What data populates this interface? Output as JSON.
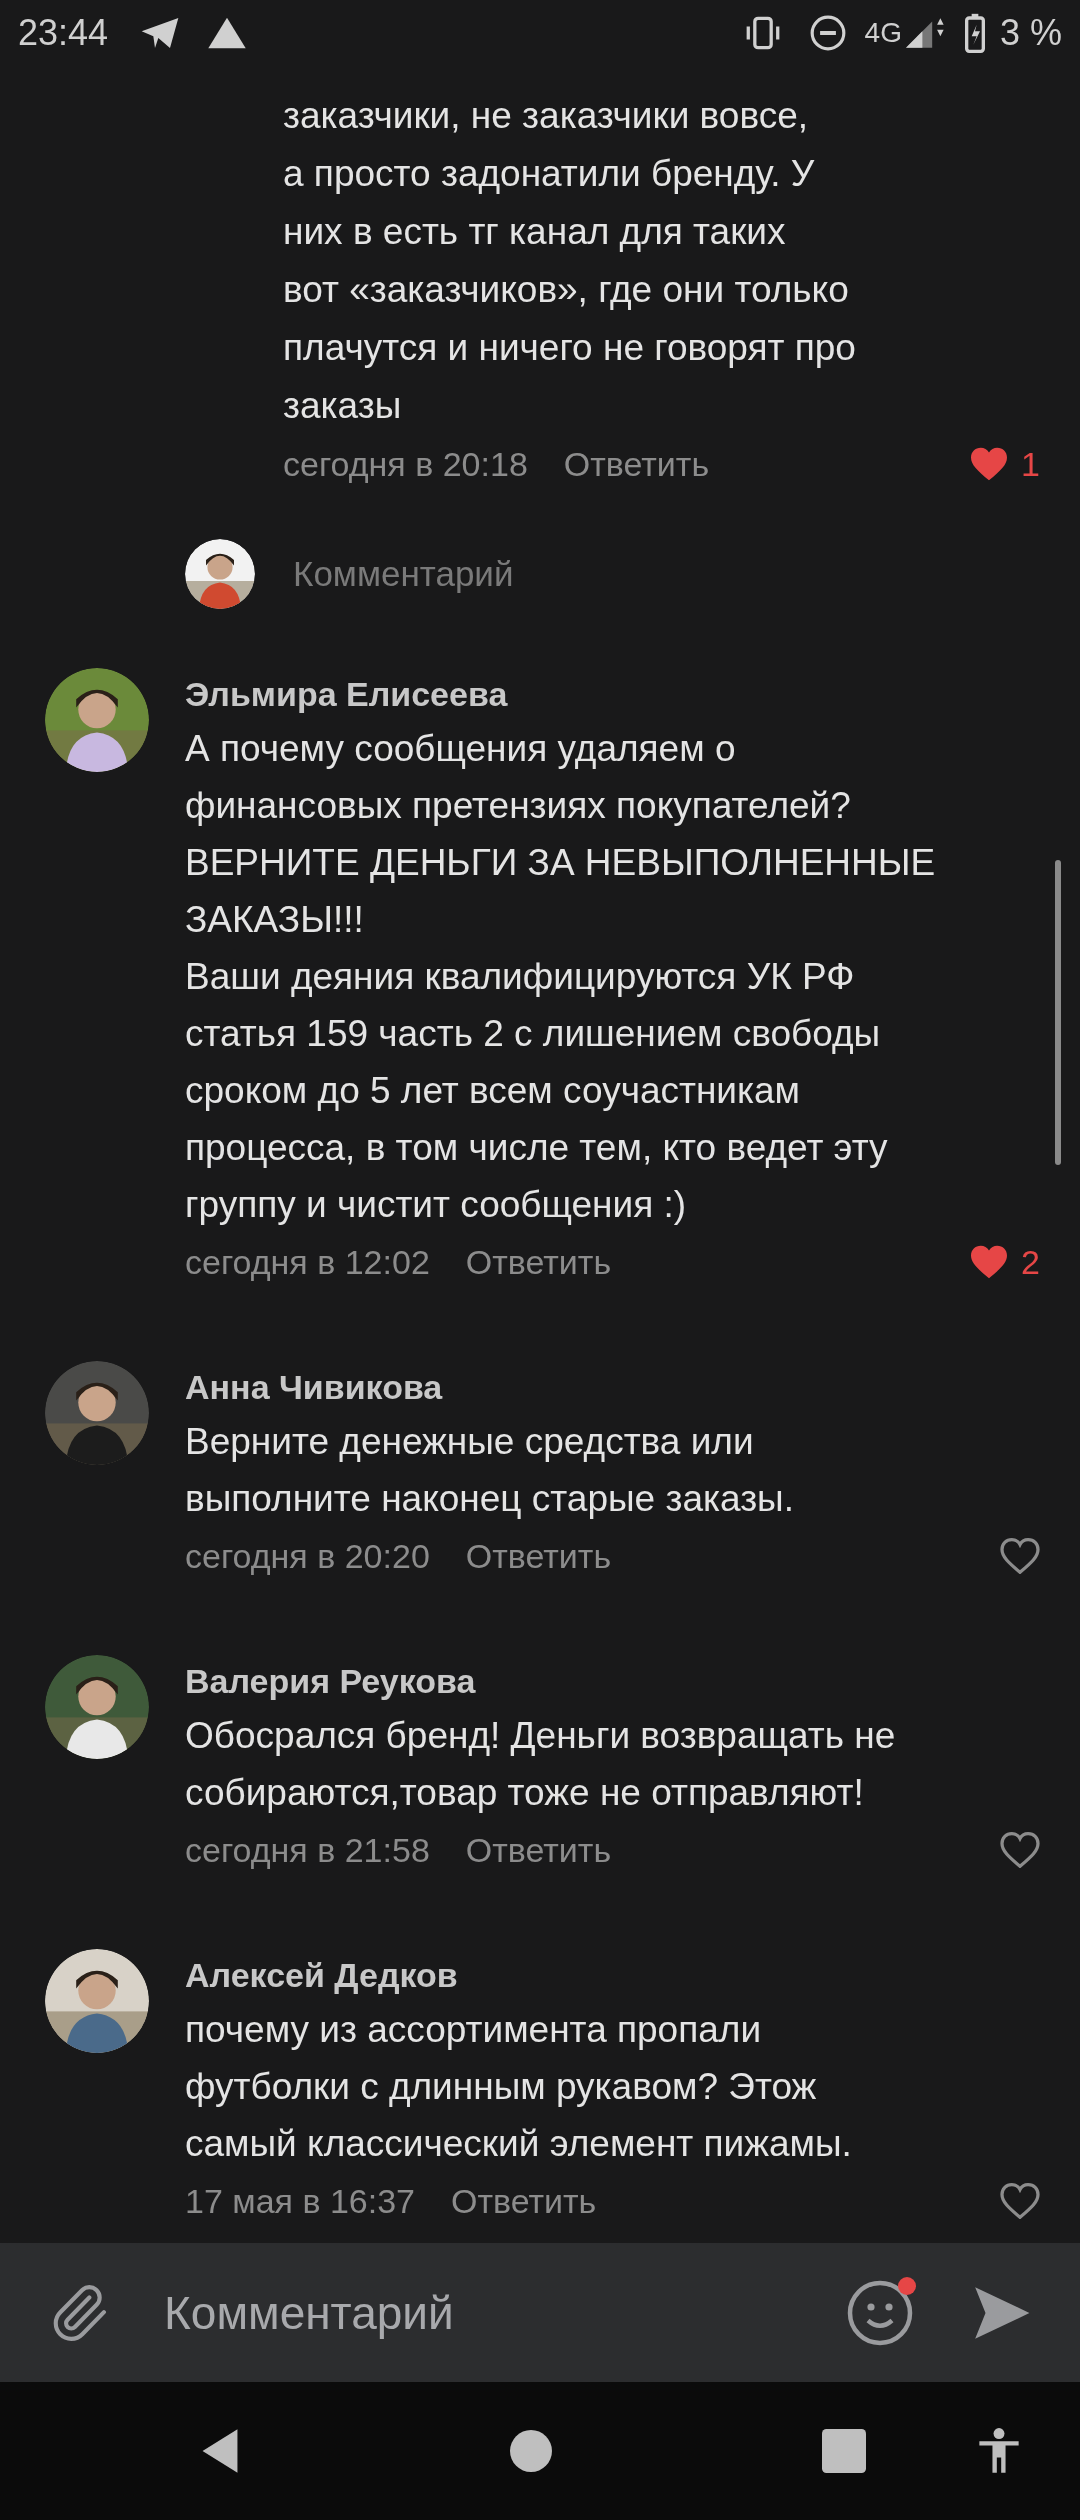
{
  "status_bar": {
    "time": "23:44",
    "network": "4G",
    "battery": "3 %"
  },
  "reply": {
    "text": "заказчики, не заказчики вовсе,\nа просто задонатили бренду. У\nних в есть тг канал для таких\nвот «заказчиков», где они только\nплачутся и ничего не говорят про\nзаказы",
    "time": "сегодня в 20:18",
    "reply_label": "Ответить",
    "liked": true,
    "likes": "1"
  },
  "comment_box": {
    "placeholder": "Комментарий"
  },
  "comments": [
    {
      "author": "Эльмира Елисеева",
      "text": "А почему сообщения удаляем о\nфинансовых претензиях покупателей?\nВЕРНИТЕ ДЕНЬГИ ЗА НЕВЫПОЛНЕННЫЕ\nЗАКАЗЫ!!!\nВаши деяния квалифицируются УК РФ\nстатья 159 часть 2 с лишением свободы\nсроком до 5 лет всем соучастникам\nпроцесса, в том числе тем, кто ведет эту\nгруппу и чистит сообщения :)",
      "time": "сегодня в 12:02",
      "reply_label": "Ответить",
      "liked": true,
      "likes": "2"
    },
    {
      "author": "Анна Чивикова",
      "text": "Верните денежные средства или\nвыполните наконец старые заказы.",
      "time": "сегодня в 20:20",
      "reply_label": "Ответить",
      "liked": false
    },
    {
      "author": "Валерия Реукова",
      "text": "Обосрался бренд! Деньги возвращать не\nсобираются,товар тоже не отправляют!",
      "time": "сегодня в 21:58",
      "reply_label": "Ответить",
      "liked": false
    },
    {
      "author": "Алексей Дедков",
      "text": "почему из ассортимента пропали\nфутболки с длинным рукавом? Этож\nсамый классический элемент пижамы.",
      "time": "17 мая в 16:37",
      "reply_label": "Ответить",
      "liked": false
    }
  ],
  "input_bar": {
    "placeholder": "Комментарий",
    "emoji_badge": true
  }
}
